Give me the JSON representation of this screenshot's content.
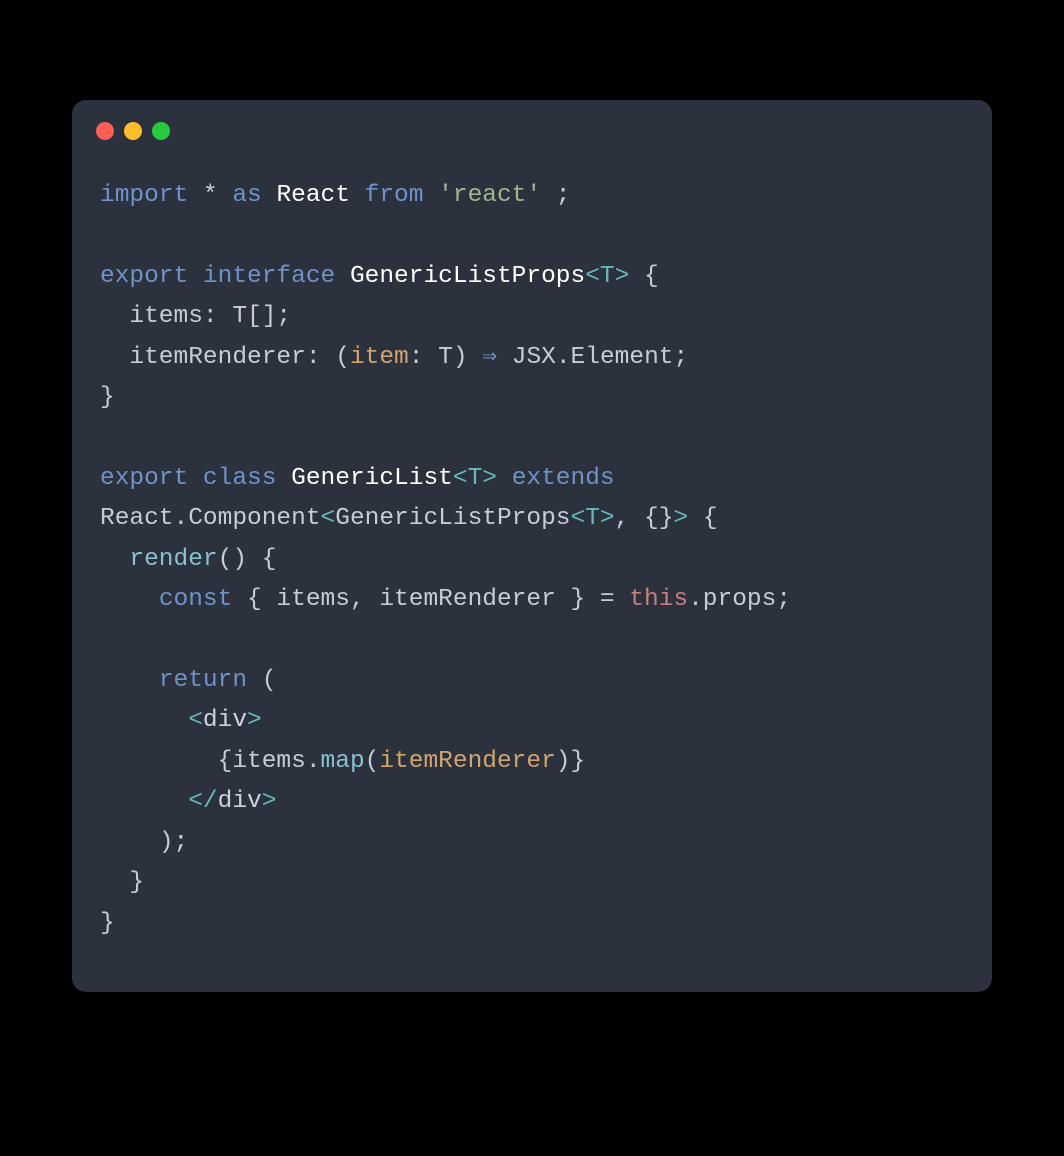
{
  "colors": {
    "bg": "#2b313d",
    "keyword": "#6f92c9",
    "plain": "#c6ccd7",
    "identifier": "#ffffff",
    "string": "#9eb88a",
    "generic": "#66b9b9",
    "param": "#d1a46f",
    "this": "#c77d7d",
    "fn": "#88c0d0"
  },
  "traffic": {
    "red": "#ff5f56",
    "yellow": "#ffbd2e",
    "green": "#27c93f"
  },
  "tokens": {
    "l1": {
      "import": "import",
      "star": "*",
      "as": "as",
      "React": "React",
      "from": "from",
      "str": "'react'",
      "semi": ";"
    },
    "l2": "",
    "l3": {
      "export": "export",
      "interface": "interface",
      "name": "GenericListProps",
      "lt": "<",
      "T": "T",
      "gt": ">",
      "brace": "{"
    },
    "l4": {
      "indent": "  ",
      "items": "items: T[];"
    },
    "l5": {
      "indent": "  ",
      "itemRenderer": "itemRenderer: (",
      "param": "item",
      "rest": ": T) ",
      "arrow": "⇒",
      "tail": " JSX.Element;"
    },
    "l6": {
      "brace": "}"
    },
    "l7": "",
    "l8": {
      "export": "export",
      "class": "class",
      "name": "GenericList",
      "lt": "<",
      "T": "T",
      "gt": ">",
      "extends": "extends "
    },
    "l9": {
      "pre": "React.Component",
      "lt": "<",
      "glp": "GenericListProps",
      "lt2": "<",
      "T": "T",
      "gt2": ">",
      "comma": ", {}",
      "gt": ">",
      "brace": " {"
    },
    "l10": {
      "indent": "  ",
      "render": "render",
      "paren": "() {"
    },
    "l11": {
      "indent": "    ",
      "const": "const",
      "mid": " { items, itemRenderer } = ",
      "this": "this",
      "tail": ".props;"
    },
    "l12": "",
    "l13": {
      "indent": "    ",
      "return": "return",
      "paren": " ("
    },
    "l14": {
      "indent": "      ",
      "open": "<",
      "tag": "div",
      "close": ">"
    },
    "l15": {
      "indent": "        ",
      "lb": "{",
      "items": "items",
      "dot": ".",
      "map": "map",
      "lp": "(",
      "ir": "itemRenderer",
      "rp": ")",
      "rb": "}"
    },
    "l16": {
      "indent": "      ",
      "open": "</",
      "tag": "div",
      "close": ">"
    },
    "l17": {
      "indent": "    ",
      "paren": ");"
    },
    "l18": {
      "indent": "  ",
      "brace": "}"
    },
    "l19": {
      "brace": "}"
    }
  }
}
